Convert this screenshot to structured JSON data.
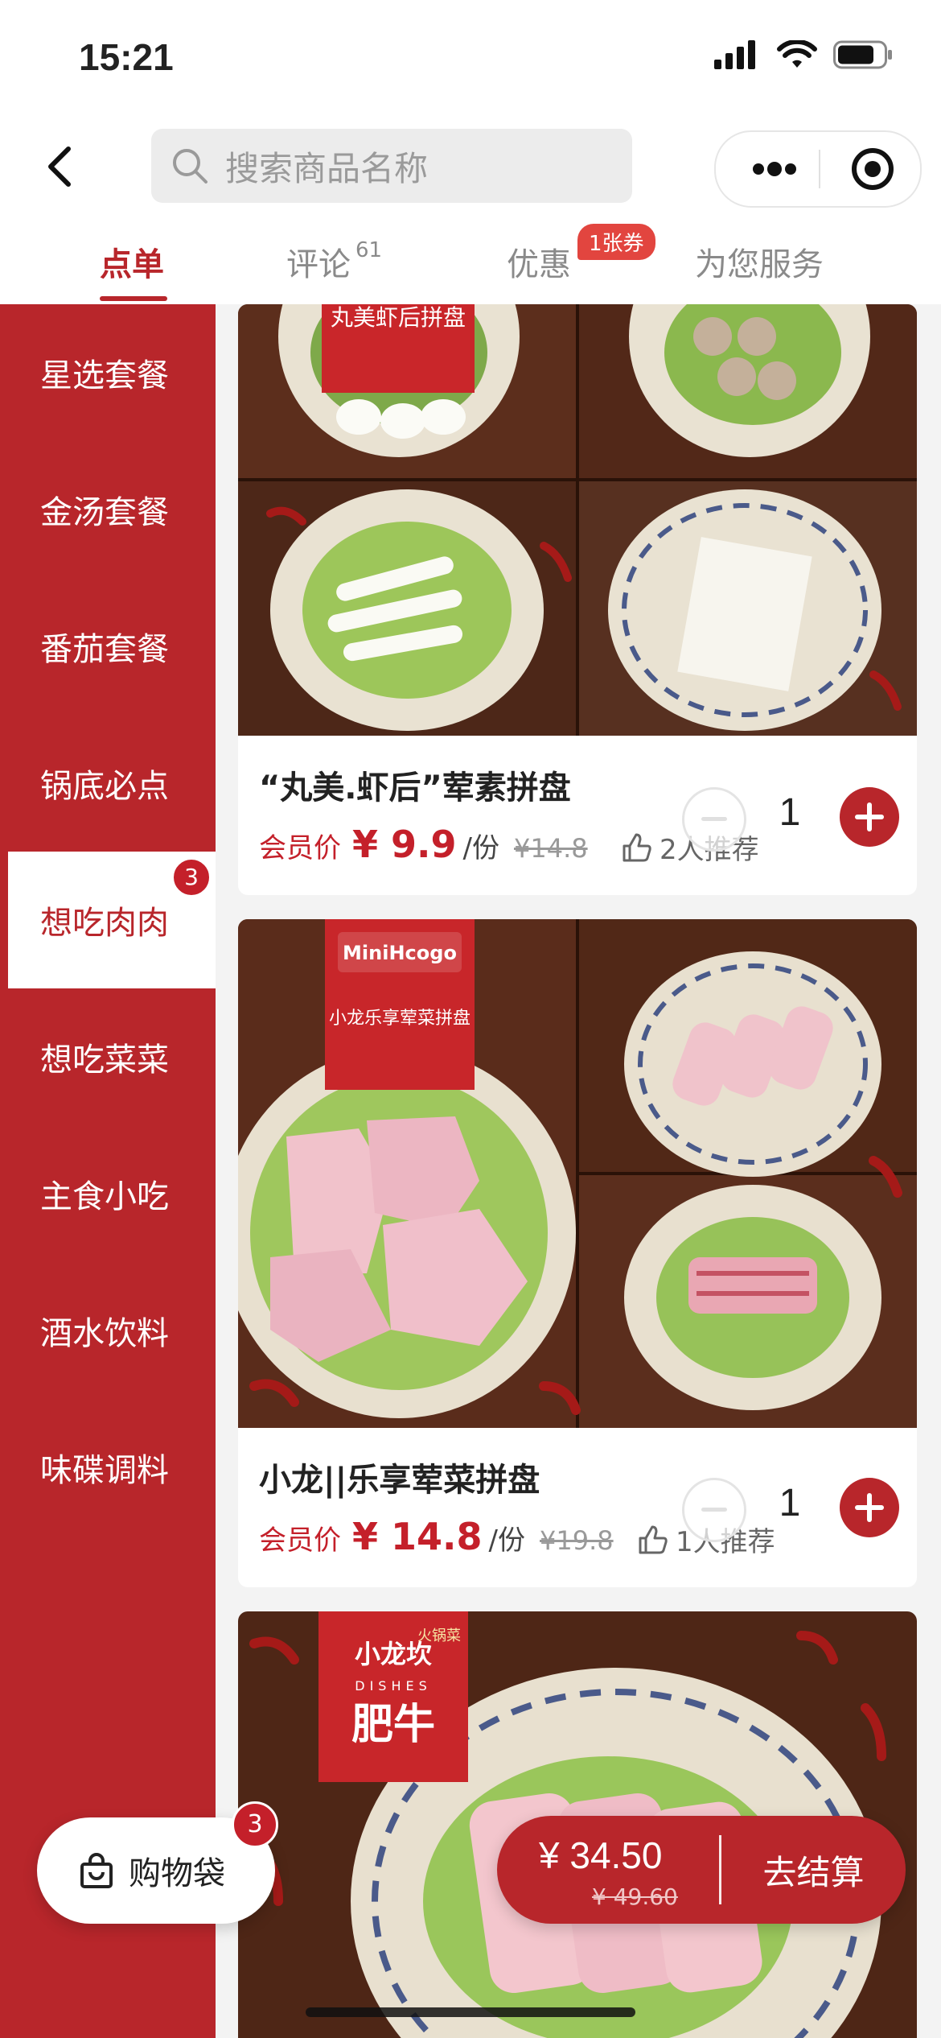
{
  "status_bar": {
    "time": "15:21"
  },
  "search": {
    "placeholder": "搜索商品名称"
  },
  "tabs": [
    {
      "label": "点单"
    },
    {
      "label": "评论",
      "count": "61"
    },
    {
      "label": "优惠",
      "badge": "1张券"
    },
    {
      "label": "为您服务"
    }
  ],
  "categories": [
    {
      "label": "星选套餐"
    },
    {
      "label": "金汤套餐"
    },
    {
      "label": "番茄套餐"
    },
    {
      "label": "锅底必点"
    },
    {
      "label": "想吃肉肉",
      "badge": "3",
      "active": true
    },
    {
      "label": "想吃菜菜"
    },
    {
      "label": "主食小吃"
    },
    {
      "label": "酒水饮料"
    },
    {
      "label": "味碟调料"
    }
  ],
  "products": [
    {
      "name": "“丸美.虾后”荤素拼盘",
      "member_label": "会员价",
      "price": "¥ 9.9",
      "unit": "/份",
      "original_price": "¥14.8",
      "recommend": "2人推荐",
      "quantity": "1",
      "image_texts": {
        "banner": "丸美虾后拼盘"
      }
    },
    {
      "name": "小龙||乐享荤菜拼盘",
      "member_label": "会员价",
      "price": "¥ 14.8",
      "unit": "/份",
      "original_price": "¥19.8",
      "recommend": "1人推荐",
      "quantity": "1",
      "image_texts": {
        "brand": "MiniHcogo",
        "banner": "小龙乐享荤菜拼盘"
      }
    },
    {
      "image_texts": {
        "brand": "小龙坎",
        "tag": "火锅菜",
        "sub": "DISHES",
        "banner": "肥牛"
      }
    }
  ],
  "cart": {
    "label": "购物袋",
    "badge": "3"
  },
  "checkout": {
    "total": "¥ 34.50",
    "original_total": "¥ 49.60",
    "button": "去结算"
  },
  "colors": {
    "primary": "#b8262b",
    "badge": "#e2453f"
  }
}
